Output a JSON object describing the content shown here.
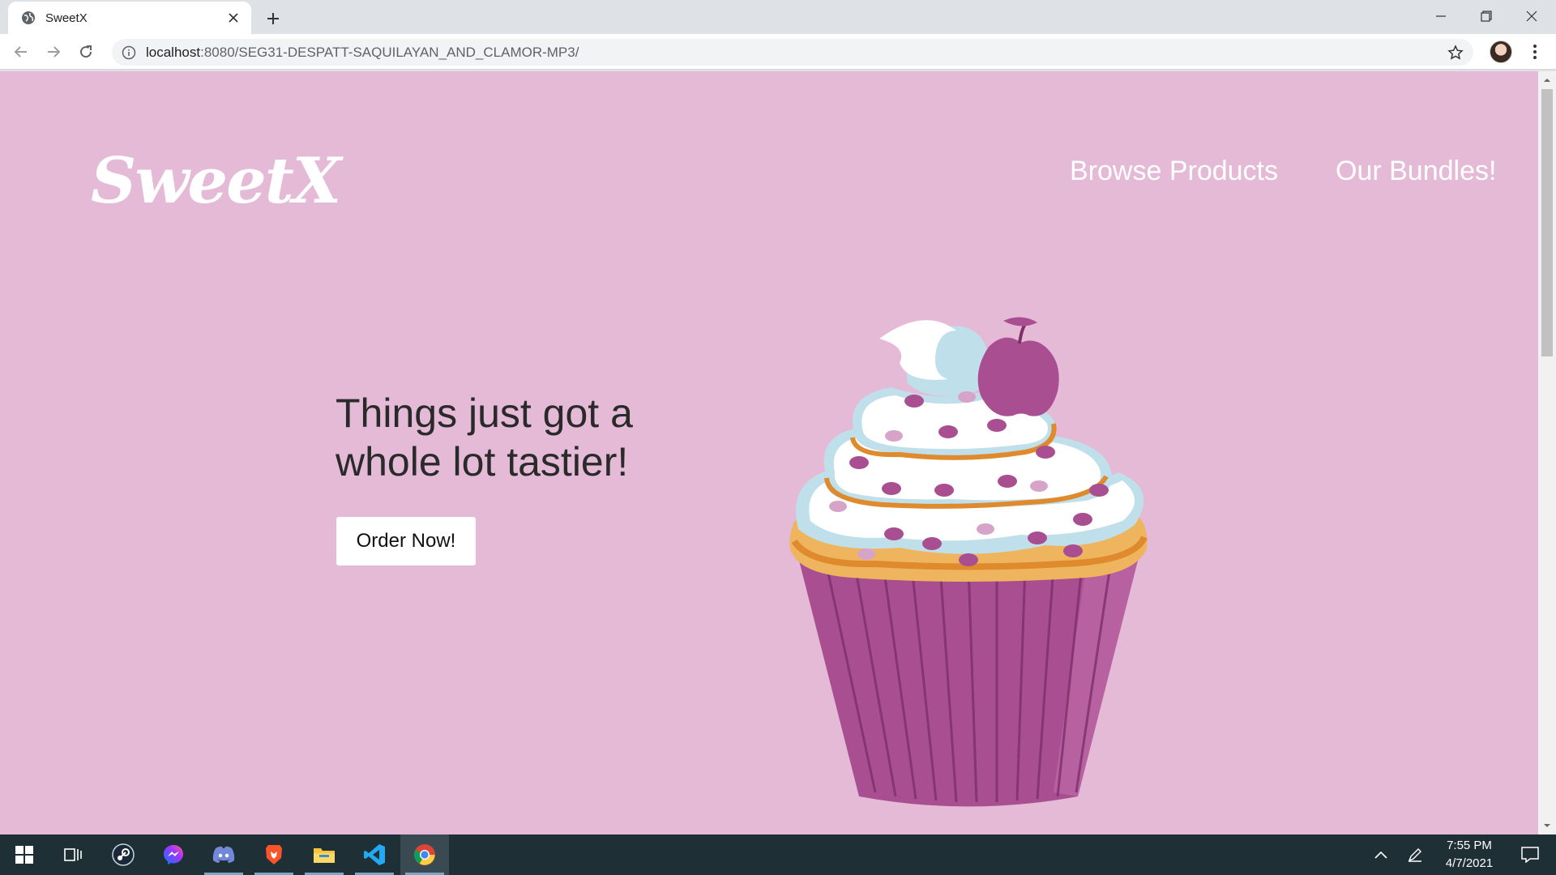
{
  "browser": {
    "tab_title": "SweetX",
    "url_host": "localhost",
    "url_rest": ":8080/SEG31-DESPATT-SAQUILAYAN_AND_CLAMOR-MP3/"
  },
  "site": {
    "logo": "SweetX",
    "nav": [
      {
        "label": "Browse Products"
      },
      {
        "label": "Our Bundles!"
      }
    ],
    "hero": {
      "line1": "Things just got a",
      "line2": "whole lot tastier!",
      "cta": "Order Now!"
    },
    "colors": {
      "background": "#e4bad6",
      "accent": "#a94f91"
    }
  },
  "taskbar": {
    "apps": [
      "start",
      "task-view",
      "steam",
      "messenger",
      "discord",
      "brave",
      "file-explorer",
      "vscode",
      "chrome"
    ],
    "time": "7:55 PM",
    "date": "4/7/2021"
  }
}
